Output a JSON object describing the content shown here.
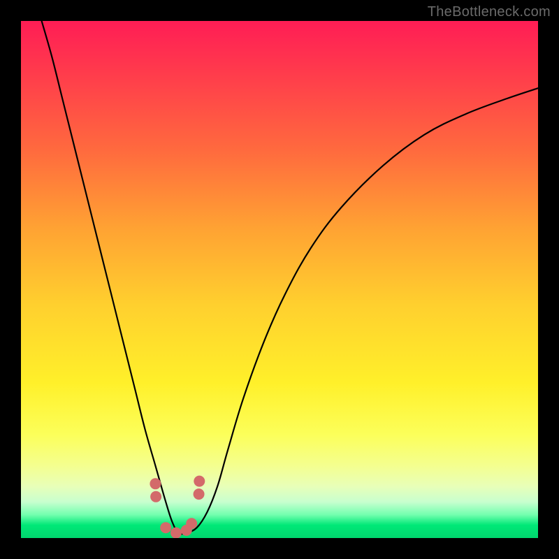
{
  "watermark": "TheBottleneck.com",
  "chart_data": {
    "type": "line",
    "title": "",
    "xlabel": "",
    "ylabel": "",
    "xlim": [
      0,
      1
    ],
    "ylim": [
      0,
      1
    ],
    "series": [
      {
        "name": "curve",
        "color": "#000000",
        "x": [
          0.04,
          0.06,
          0.08,
          0.1,
          0.12,
          0.14,
          0.16,
          0.18,
          0.2,
          0.22,
          0.24,
          0.26,
          0.28,
          0.293,
          0.305,
          0.32,
          0.34,
          0.36,
          0.38,
          0.4,
          0.43,
          0.47,
          0.51,
          0.56,
          0.62,
          0.7,
          0.78,
          0.86,
          0.94,
          1.0
        ],
        "y": [
          1.0,
          0.93,
          0.85,
          0.77,
          0.69,
          0.61,
          0.53,
          0.45,
          0.37,
          0.29,
          0.21,
          0.14,
          0.07,
          0.03,
          0.01,
          0.01,
          0.02,
          0.05,
          0.1,
          0.17,
          0.27,
          0.38,
          0.47,
          0.56,
          0.64,
          0.72,
          0.78,
          0.82,
          0.85,
          0.87
        ]
      },
      {
        "name": "dots",
        "color": "#d36a6a",
        "x": [
          0.26,
          0.261,
          0.28,
          0.3,
          0.32,
          0.33,
          0.344,
          0.345
        ],
        "y": [
          0.105,
          0.08,
          0.02,
          0.01,
          0.015,
          0.028,
          0.085,
          0.11
        ]
      }
    ],
    "background_gradient": [
      "#ff1d55",
      "#ff6a3e",
      "#ffd02e",
      "#fcff5a",
      "#00d66e"
    ]
  }
}
